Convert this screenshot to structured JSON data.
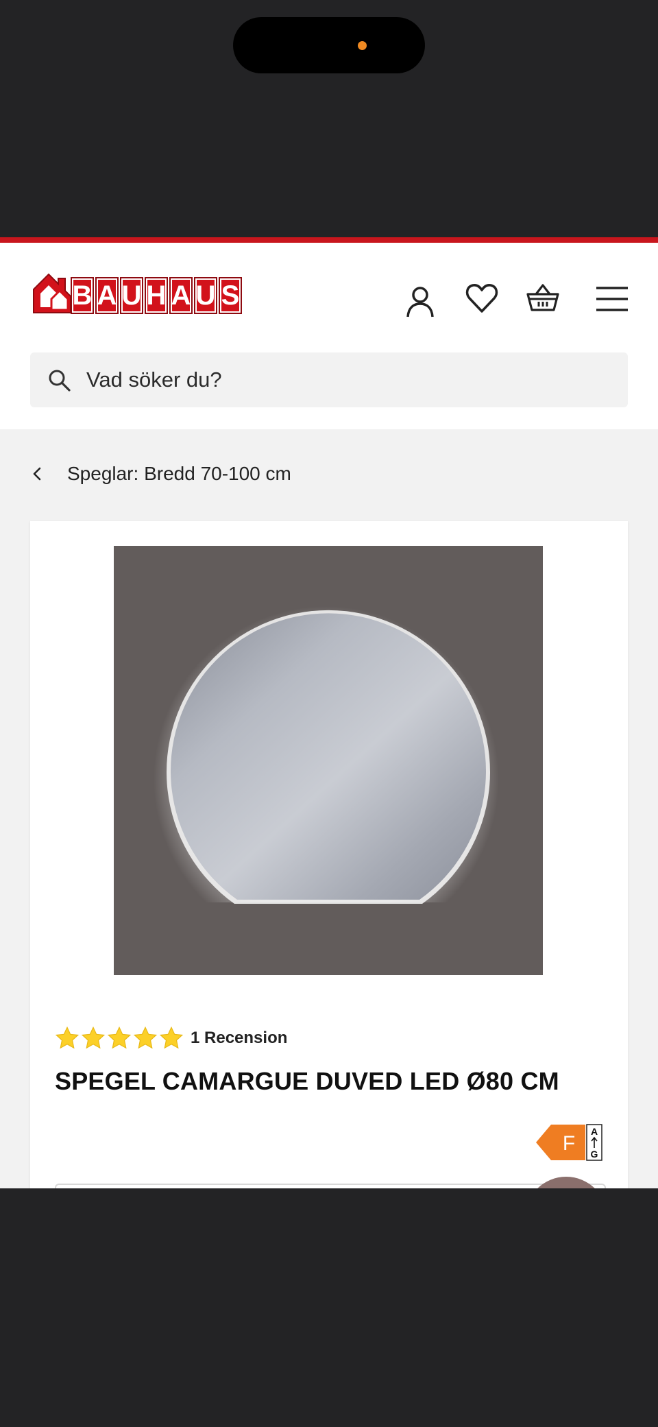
{
  "brand": {
    "logo_text": "BAUHAUS",
    "accent_color": "#c8161d"
  },
  "header": {
    "icons": [
      "user-icon",
      "heart-icon",
      "basket-icon",
      "menu-icon"
    ]
  },
  "search": {
    "placeholder": "Vad söker du?"
  },
  "breadcrumb": {
    "label": "Speglar: Bredd 70-100 cm"
  },
  "product": {
    "rating": 5,
    "review_count_text": "1 Recension",
    "title": "SPEGEL CAMARGUE DUVED LED Ø80 CM",
    "energy_class": "F",
    "energy_scale_top": "A",
    "energy_scale_bottom": "G",
    "energy_color": "#ef7d22"
  }
}
